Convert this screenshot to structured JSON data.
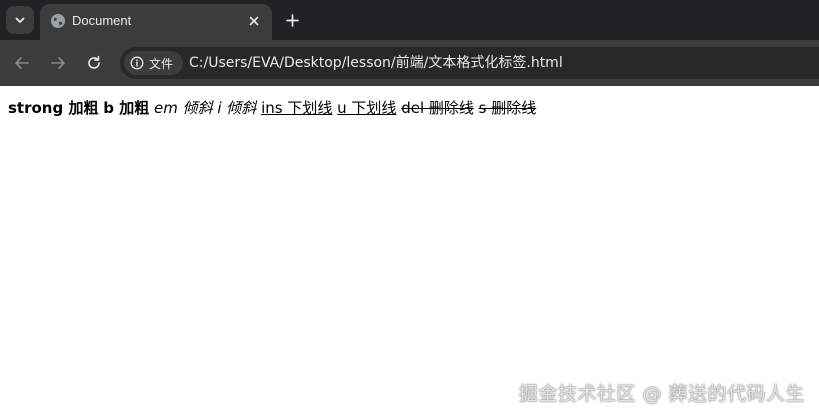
{
  "tab": {
    "title": "Document",
    "favicon": "globe-icon",
    "close_icon": "close-icon",
    "menu_icon": "chevron-down-icon",
    "new_tab_icon": "plus-icon"
  },
  "toolbar": {
    "back_icon": "back-arrow-icon",
    "forward_icon": "forward-arrow-icon",
    "reload_icon": "reload-icon",
    "site_info_icon": "info-icon",
    "site_info_label": "文件",
    "url": "C:/Users/EVA/Desktop/lesson/前端/文本格式化标签.html"
  },
  "content": {
    "strong_text": "strong 加粗",
    "b_text": "b 加粗",
    "em_text": "em 倾斜",
    "i_text": "i 倾斜",
    "ins_text": "ins 下划线",
    "u_text": "u 下划线",
    "del_text": "del 删除线",
    "s_text": "s 删除线"
  },
  "watermark": "掘金技术社区 @ 葬送的代码人生",
  "colors": {
    "tabstrip_bg": "#202124",
    "toolbar_bg": "#3c3c3c",
    "omnibox_bg": "#282828",
    "text_light": "#e8eaed",
    "page_bg": "#ffffff"
  }
}
